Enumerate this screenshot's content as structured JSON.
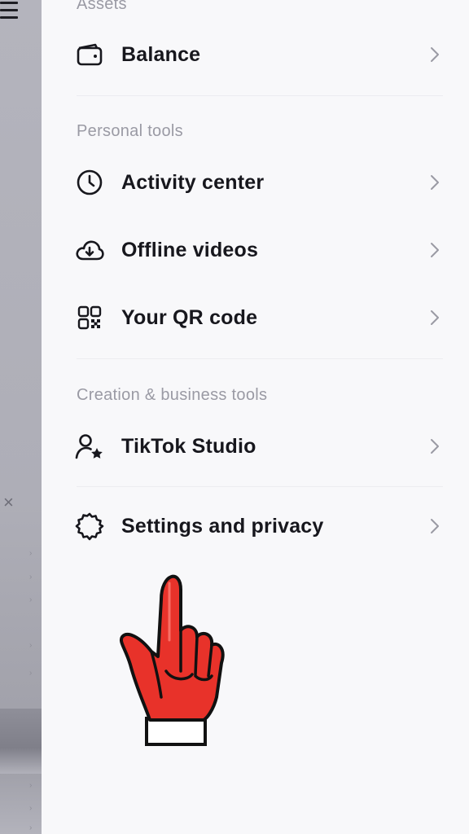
{
  "sections": {
    "assets_title": "Assets",
    "personal_title": "Personal tools",
    "creation_title": "Creation & business tools"
  },
  "items": {
    "balance": {
      "label": "Balance",
      "icon": "wallet-icon"
    },
    "activity": {
      "label": "Activity center",
      "icon": "clock-icon"
    },
    "offline": {
      "label": "Offline videos",
      "icon": "cloud-download-icon"
    },
    "qr": {
      "label": "Your QR code",
      "icon": "qr-code-icon"
    },
    "studio": {
      "label": "TikTok Studio",
      "icon": "person-star-icon"
    },
    "settings": {
      "label": "Settings and privacy",
      "icon": "gear-icon"
    }
  },
  "background": {
    "close_glyph": "×"
  },
  "colors": {
    "text": "#17171d",
    "section_title": "#9a9aa4",
    "drawer_bg": "#f8f8fa",
    "pointer_hand": "#e8322a"
  }
}
